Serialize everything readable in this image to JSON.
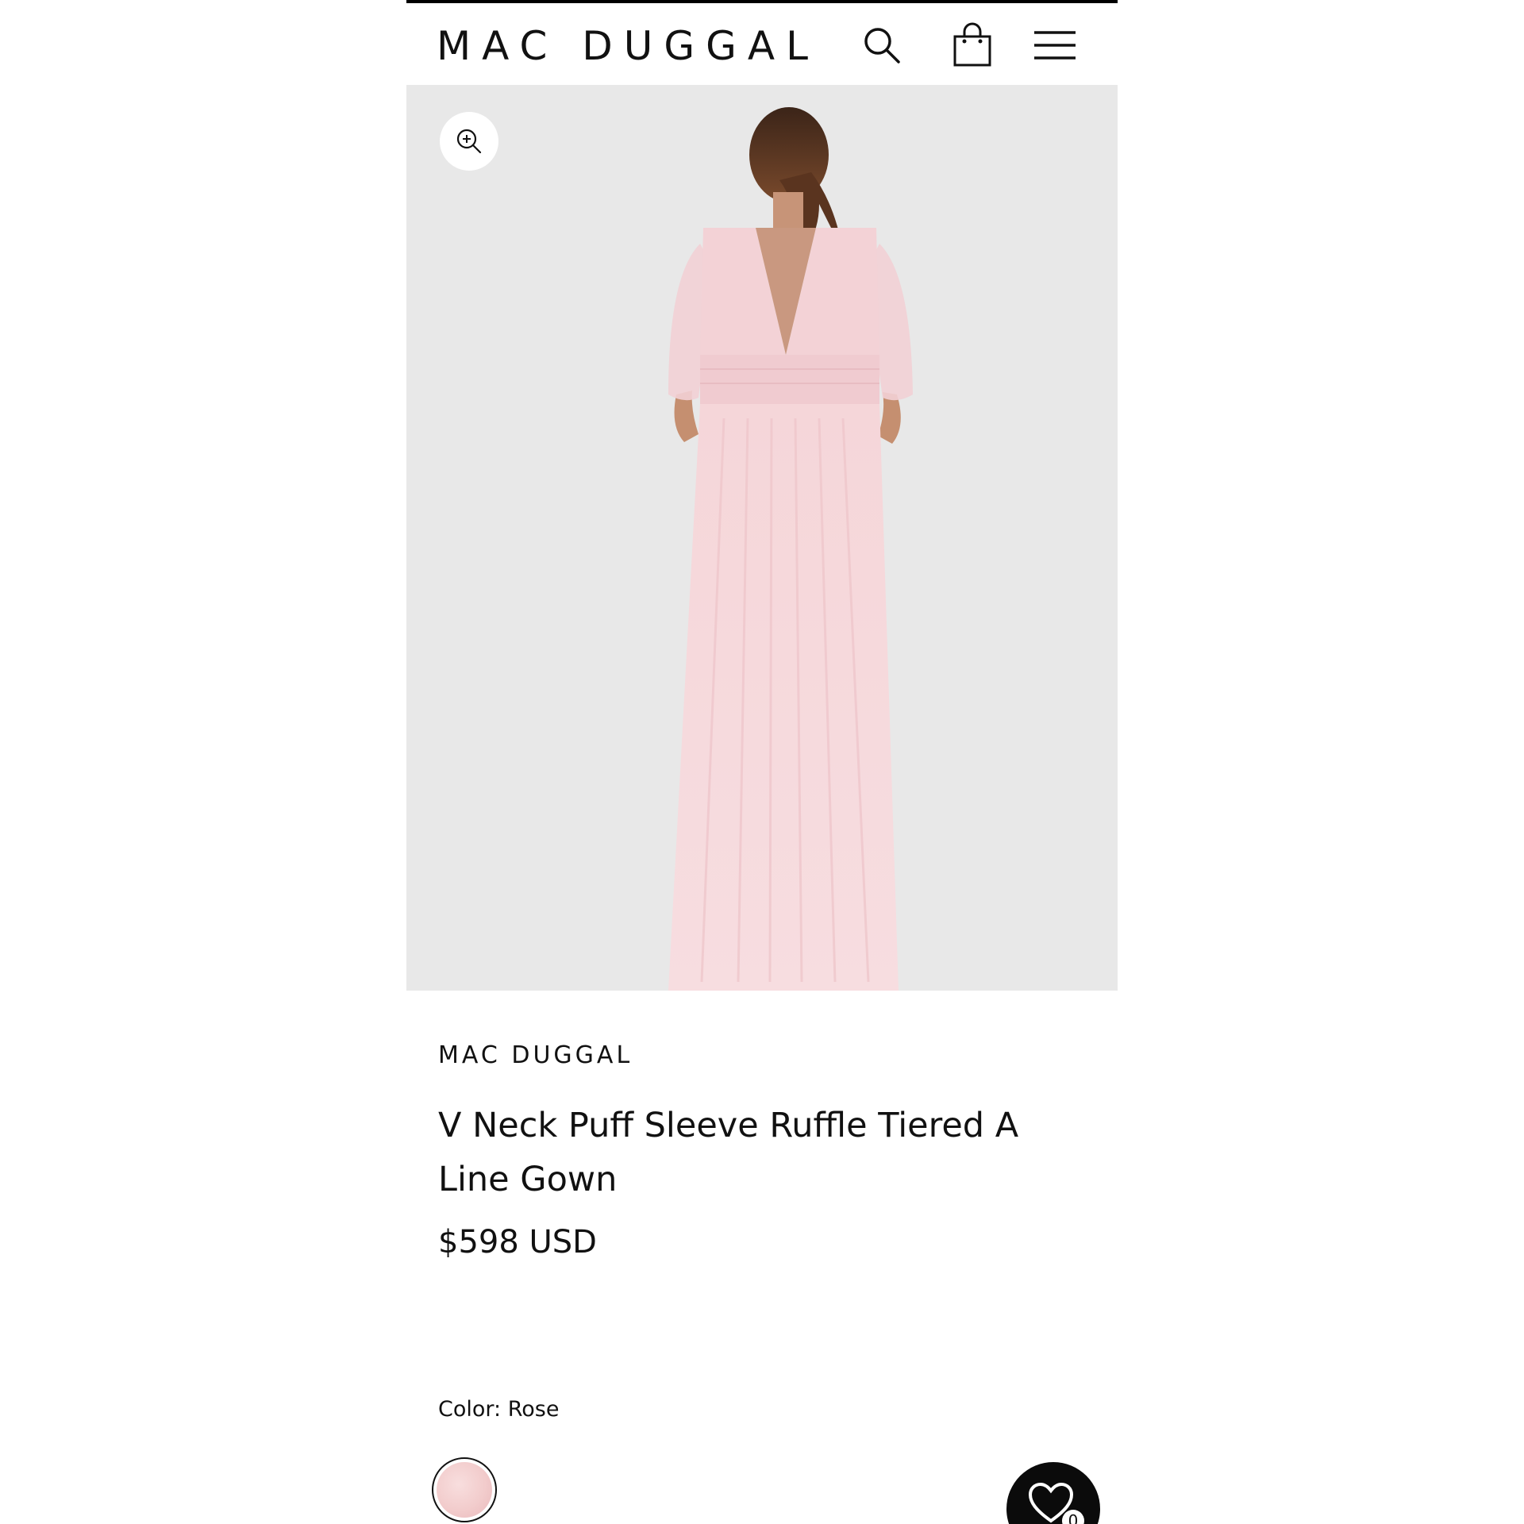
{
  "header": {
    "logo": "MAC DUGGAL",
    "icons": [
      "search-icon",
      "shopping-bag-icon",
      "hamburger-menu-icon"
    ]
  },
  "hero": {
    "zoom_icon": "zoom-in-icon",
    "image_alt": "Model wearing rose V neck puff sleeve ruffle tiered gown, back view"
  },
  "product": {
    "brand": "MAC DUGGAL",
    "title": "V Neck Puff Sleeve Ruffle Tiered A Line Gown",
    "price": "$598 USD",
    "color_label": "Color:",
    "color_value": "Rose"
  },
  "wishlist": {
    "icon": "heart-icon",
    "count": "0"
  },
  "colors": {
    "background": "#ffffff",
    "hero_bg": "#e8e8e8",
    "dress": "#f4d3d6",
    "text": "#111111",
    "wishlist_bg": "#0b0b0b"
  }
}
